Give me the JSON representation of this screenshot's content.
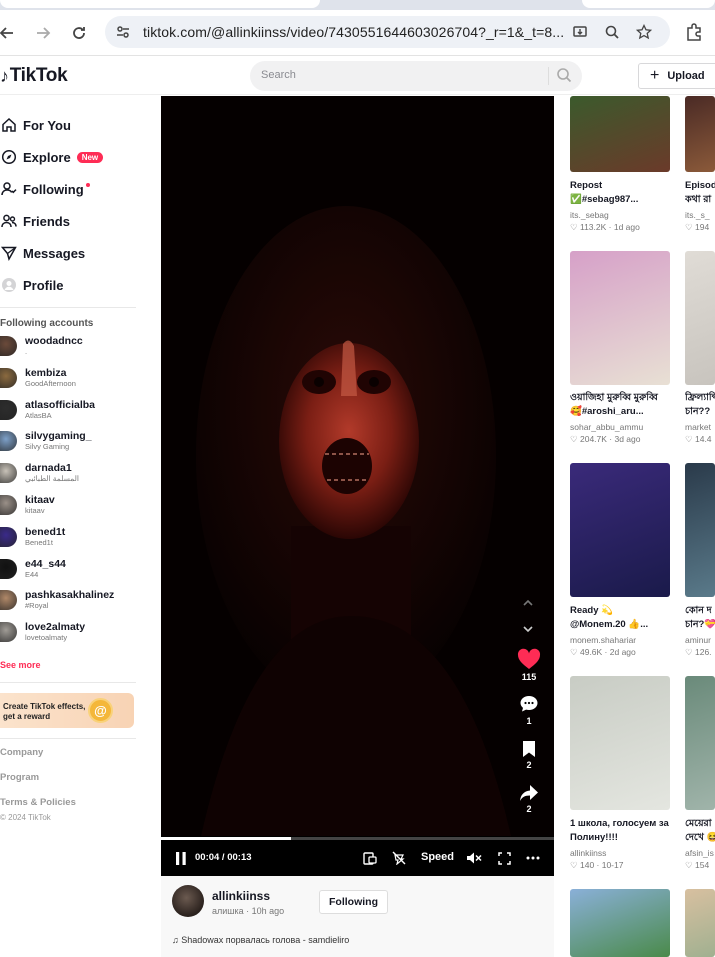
{
  "browser": {
    "url": "tiktok.com/@allinkiinss/video/7430551644603026704?_r=1&_t=8..."
  },
  "header": {
    "logo_text": "TikTok",
    "search_placeholder": "Search",
    "upload_label": "Upload"
  },
  "sidebar": {
    "nav": [
      {
        "label": "For You",
        "icon": "home-icon"
      },
      {
        "label": "Explore",
        "icon": "compass-icon",
        "badge": "New"
      },
      {
        "label": "Following",
        "icon": "following-icon"
      },
      {
        "label": "Friends",
        "icon": "friends-icon"
      },
      {
        "label": "Messages",
        "icon": "messages-icon"
      },
      {
        "label": "Profile",
        "icon": "profile-icon"
      }
    ],
    "following_title": "Following accounts",
    "accounts": [
      {
        "name": "woodadncc",
        "sub": ".",
        "color": "#6b4a3a"
      },
      {
        "name": "kembiza",
        "sub": "GoodAfternoon",
        "color": "#8b6a3f"
      },
      {
        "name": "atlasofficialba",
        "sub": "AtlasBA",
        "color": "#2d2d2d"
      },
      {
        "name": "silvygaming_",
        "sub": "Silvy Gaming",
        "color": "#7da0c8"
      },
      {
        "name": "darnada1",
        "sub": "المسلمة الطبائبي",
        "color": "#c8c2b8"
      },
      {
        "name": "kitaav",
        "sub": "kitaav",
        "color": "#9a9088"
      },
      {
        "name": "bened1t",
        "sub": "Bened1t",
        "color": "#3a2a8a"
      },
      {
        "name": "e44_s44",
        "sub": "E44",
        "color": "#111111"
      },
      {
        "name": "pashkasakhalinez",
        "sub": "#Royal",
        "color": "#b08868"
      },
      {
        "name": "love2almaty",
        "sub": "lovetoalmaty",
        "color": "#a09c96"
      }
    ],
    "see_more": "See more",
    "effects": "Create TikTok effects, get a reward",
    "footer": [
      "Company",
      "Program",
      "Terms & Policies"
    ],
    "copyright": "© 2024 TikTok"
  },
  "video": {
    "likes": "115",
    "comments": "1",
    "saves": "2",
    "shares": "2",
    "time": "00:04 / 00:13",
    "speed_label": "Speed",
    "progress": 0.33
  },
  "post": {
    "username": "allinkiinss",
    "meta": "алишка · 10h ago",
    "follow_label": "Following",
    "music": "Shadowax порвалась голова - samdieliro"
  },
  "grid": [
    {
      "cap1": "Repost",
      "cap2": "✅#sebag987...",
      "author": "its._sebag",
      "stats": "113.2K · 1d ago"
    },
    {
      "cap1": "Episod",
      "cap2": "কথা রা",
      "author": "its._s_",
      "stats": "194"
    },
    {
      "cap1": "ওয়াজিহা মুরুব্বি মুরুব্বি",
      "cap2": "🥰#aroshi_aru...",
      "author": "sohar_abbu_ammu",
      "stats": "204.7K · 3d ago"
    },
    {
      "cap1": "ফ্রিল্যান্সি",
      "cap2": "চান??",
      "author": "market",
      "stats": "14.4"
    },
    {
      "cap1": "Ready 💫",
      "cap2": "@Monem.20 👍...",
      "author": "monem.shahariar",
      "stats": "49.6K · 2d ago"
    },
    {
      "cap1": "কোন দ",
      "cap2": "চান?💝",
      "author": "aminur",
      "stats": "126."
    },
    {
      "cap1": "1 школа, голосуем за",
      "cap2": "Полину!!!!",
      "author": "allinkiinss",
      "stats": "140 · 10-17"
    },
    {
      "cap1": "মেয়েরা",
      "cap2": "দেখে 😆",
      "author": "afsin_is",
      "stats": "154"
    }
  ],
  "colors": {
    "accent": "#fe2c55",
    "badge": "#fe2c55"
  }
}
